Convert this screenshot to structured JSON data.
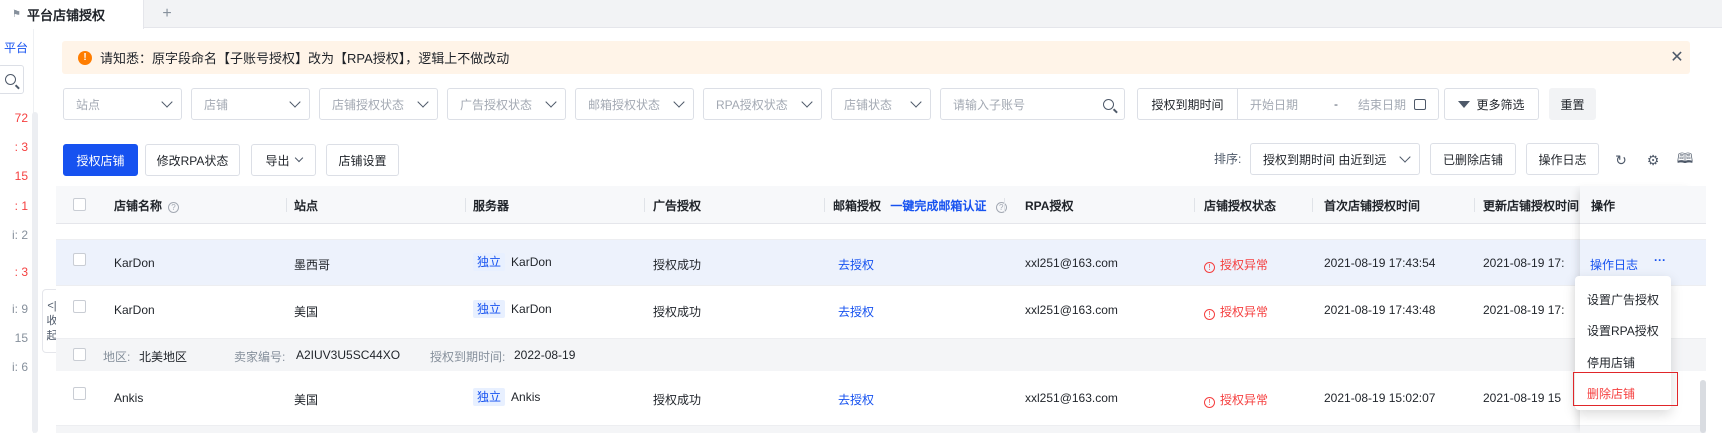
{
  "tab": {
    "title": "平台店铺授权",
    "add": "+"
  },
  "left_strip": {
    "top_label": "平台",
    "items": [
      {
        "text": "72",
        "color": "#f53f3f"
      },
      {
        "text": ": 3",
        "color": "#f53f3f"
      },
      {
        "text": "15",
        "color": "#f53f3f"
      },
      {
        "text": ": 1",
        "color": "#f53f3f"
      },
      {
        "text": "i: 2",
        "color": "#86909c"
      },
      {
        "text": ": 3",
        "color": "#f53f3f"
      },
      {
        "text": "i: 9",
        "color": "#86909c"
      },
      {
        "text": "15",
        "color": "#86909c"
      },
      {
        "text": "i: 6",
        "color": "#86909c"
      }
    ],
    "collapse": [
      "<|",
      "收",
      "起"
    ]
  },
  "notice": {
    "text": "请知悉：原字段命名【子账号授权】改为【RPA授权】，逻辑上不做改动",
    "icon": "warning-icon"
  },
  "filters": {
    "site": "站点",
    "store": "店铺",
    "store_auth_status": "店铺授权状态",
    "ad_auth_status": "广告授权状态",
    "email_auth_status": "邮箱授权状态",
    "rpa_auth_status": "RPA授权状态",
    "store_status": "店铺状态",
    "sub_account_placeholder": "请输入子账号",
    "expiry_label": "授权到期时间",
    "start_date": "开始日期",
    "date_sep": "-",
    "end_date": "结束日期",
    "more_filters": "更多筛选",
    "reset": "重置"
  },
  "toolbar": {
    "authorize": "授权店铺",
    "modify_rpa": "修改RPA状态",
    "export": "导出",
    "store_settings": "店铺设置",
    "sort_label": "排序:",
    "sort_value": "授权到期时间 由近到远",
    "deleted_stores": "已删除店铺",
    "op_log": "操作日志"
  },
  "table": {
    "headers": {
      "name": "店铺名称",
      "site": "站点",
      "server": "服务器",
      "ad_auth": "广告授权",
      "email_auth": "邮箱授权",
      "email_link": "一键完成邮箱认证",
      "rpa_auth": "RPA授权",
      "store_auth_status": "店铺授权状态",
      "first_auth_time": "首次店铺授权时间",
      "update_auth_time": "更新店铺授权时间",
      "ops": "操作"
    },
    "rows": [
      {
        "name": "KarDon",
        "site": "墨西哥",
        "server_tag": "独立",
        "server": "KarDon",
        "ad": "授权成功",
        "email": "去授权",
        "rpa": "xxl251@163.com",
        "status": "授权异常",
        "first": "2021-08-19 17:43:54",
        "update": "2021-08-19 17:",
        "op": "操作日志",
        "more": "···"
      },
      {
        "name": "KarDon",
        "site": "美国",
        "server_tag": "独立",
        "server": "KarDon",
        "ad": "授权成功",
        "email": "去授权",
        "rpa": "xxl251@163.com",
        "status": "授权异常",
        "first": "2021-08-19 17:43:48",
        "update": "2021-08-19 17:"
      },
      {
        "name": "Ankis",
        "site": "美国",
        "server_tag": "独立",
        "server": "Ankis",
        "ad": "授权成功",
        "email": "去授权",
        "rpa": "xxl251@163.com",
        "status": "授权异常",
        "first": "2021-08-19 15:02:07",
        "update": "2021-08-19 15"
      }
    ],
    "group": {
      "region_label": "地区:",
      "region": "北美地区",
      "seller_label": "卖家编号:",
      "seller": "A2IUV3U5SC44XO",
      "expiry_label": "授权到期时间:",
      "expiry": "2022-08-19"
    }
  },
  "dropdown": {
    "items": [
      "设置广告授权",
      "设置RPA授权",
      "停用店铺",
      "删除店铺"
    ],
    "danger_color": "#f53f3f"
  },
  "colors": {
    "primary": "#1652f0",
    "danger": "#f53f3f",
    "warning": "#ff7d00"
  }
}
